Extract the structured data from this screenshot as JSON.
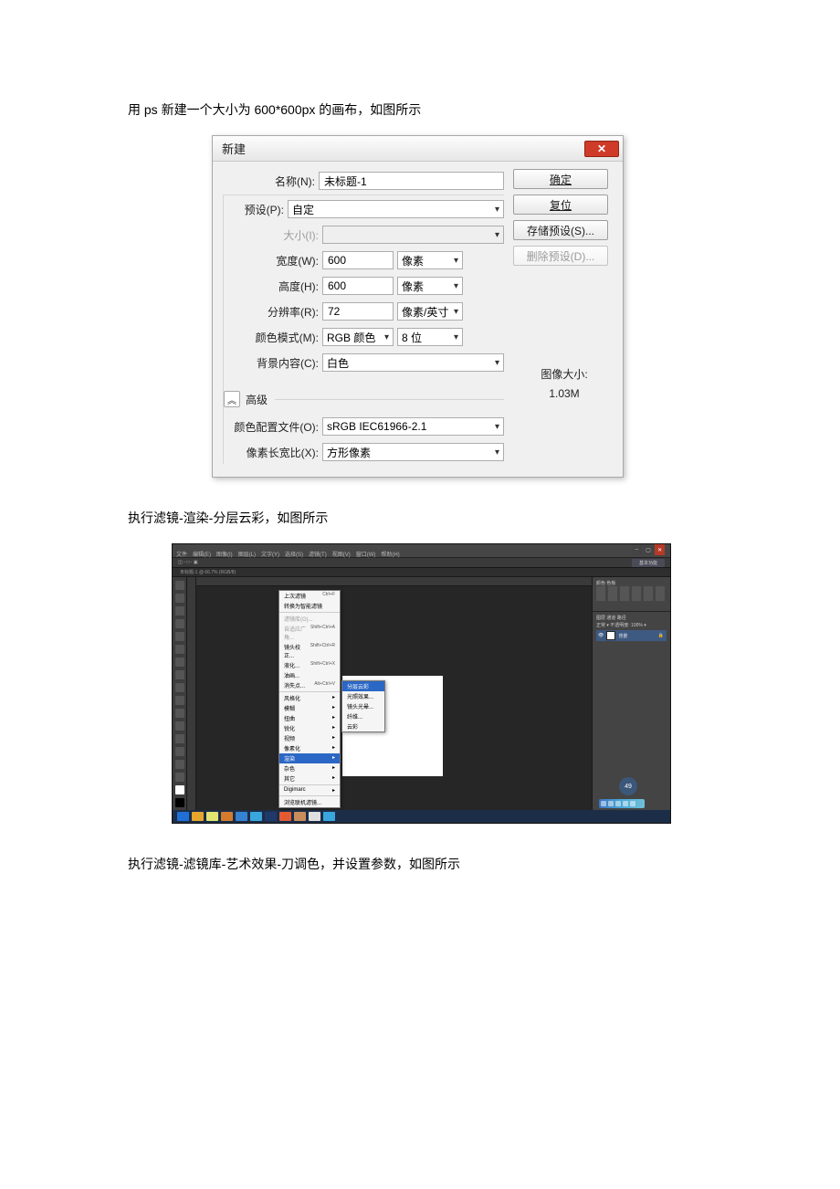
{
  "doc": {
    "line1": "用 ps 新建一个大小为 600*600px 的画布，如图所示",
    "line2": "执行滤镜-渲染-分层云彩，如图所示",
    "line3": "执行滤镜-滤镜库-艺术效果-刀调色，并设置参数，如图所示"
  },
  "dialog": {
    "title": "新建",
    "close": "✕",
    "labels": {
      "name": "名称(N):",
      "preset": "预设(P):",
      "size": "大小(I):",
      "width": "宽度(W):",
      "height": "高度(H):",
      "resolution": "分辨率(R):",
      "colormode": "颜色模式(M):",
      "bgcontent": "背景内容(C):",
      "advanced": "高级",
      "profile": "颜色配置文件(O):",
      "pixelratio": "像素长宽比(X):"
    },
    "values": {
      "name": "未标题-1",
      "preset": "自定",
      "width": "600",
      "width_unit": "像素",
      "height": "600",
      "height_unit": "像素",
      "resolution": "72",
      "resolution_unit": "像素/英寸",
      "colormode": "RGB 颜色",
      "depth": "8 位",
      "bgcontent": "白色",
      "profile": "sRGB IEC61966-2.1",
      "pixelratio": "方形像素"
    },
    "buttons": {
      "ok": "确定",
      "reset": "复位",
      "savepreset": "存储预设(S)...",
      "deletepreset": "删除预设(D)..."
    },
    "imagesize_label": "图像大小:",
    "imagesize_value": "1.03M",
    "adv_chevron": "︽"
  },
  "ps": {
    "menus": [
      "文件",
      "编辑(E)",
      "图像(I)",
      "图层(L)",
      "文字(Y)",
      "选择(S)",
      "滤镜(T)",
      "视图(V)",
      "窗口(W)",
      "帮助(H)"
    ],
    "optbar_right": "基本功能",
    "tab": "未标题-1 @ 66.7% (RGB/8)",
    "filter_menu": [
      {
        "label": "上次滤镜",
        "shortcut": "Ctrl+F"
      },
      {
        "label": "转换为智能滤镜"
      },
      {
        "sep": true
      },
      {
        "label": "滤镜库(G)...",
        "disabled": true
      },
      {
        "label": "自适应广角...",
        "shortcut": "Shift+Ctrl+A",
        "disabled": true
      },
      {
        "label": "镜头校正...",
        "shortcut": "Shift+Ctrl+R"
      },
      {
        "label": "液化...",
        "shortcut": "Shift+Ctrl+X"
      },
      {
        "label": "油画..."
      },
      {
        "label": "消失点...",
        "shortcut": "Alt+Ctrl+V"
      },
      {
        "sep": true
      },
      {
        "label": "风格化",
        "arrow": true
      },
      {
        "label": "模糊",
        "arrow": true
      },
      {
        "label": "扭曲",
        "arrow": true
      },
      {
        "label": "锐化",
        "arrow": true
      },
      {
        "label": "视频",
        "arrow": true
      },
      {
        "label": "像素化",
        "arrow": true
      },
      {
        "label": "渲染",
        "arrow": true,
        "hl": true
      },
      {
        "label": "杂色",
        "arrow": true
      },
      {
        "label": "其它",
        "arrow": true
      },
      {
        "sep": true
      },
      {
        "label": "Digimarc",
        "arrow": true
      },
      {
        "sep": true
      },
      {
        "label": "浏览联机滤镜..."
      }
    ],
    "submenu": [
      {
        "label": "分层云彩",
        "hl": true
      },
      {
        "label": "光照效果..."
      },
      {
        "label": "镜头光晕..."
      },
      {
        "label": "纤维..."
      },
      {
        "label": "云彩"
      }
    ],
    "layer_name": "背景",
    "disk_num": "49",
    "taskbar_colors": [
      "#1f6fd6",
      "#e6a62c",
      "#e1e470",
      "#d47b2e",
      "#3582d0",
      "#3aa6de",
      "#1f3a6a",
      "#e45b32",
      "#c98c5b",
      "#e0e0e0",
      "#3aa6de"
    ]
  }
}
